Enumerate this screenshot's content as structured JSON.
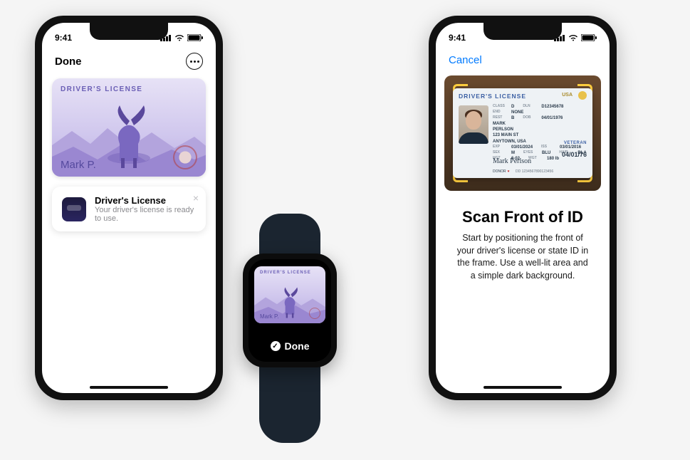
{
  "statusbar": {
    "time": "9:41"
  },
  "left_phone": {
    "done_label": "Done",
    "card": {
      "title": "DRIVER'S LICENSE",
      "holder_name": "Mark P."
    },
    "notification": {
      "title": "Driver's License",
      "subtitle": "Your driver's license is ready to use."
    }
  },
  "watch": {
    "card": {
      "title": "DRIVER'S LICENSE",
      "holder_name": "Mark P."
    },
    "done_label": "Done"
  },
  "right_phone": {
    "cancel_label": "Cancel",
    "scan_title": "Scan Front of ID",
    "scan_body": "Start by positioning the front of your driver's license or state ID in the frame. Use a well-lit area and a simple dark background.",
    "id": {
      "title": "DRIVER'S LICENSE",
      "country": "USA",
      "class_lbl": "CLASS",
      "class": "D",
      "dln_lbl": "DLN",
      "dln": "D12345678",
      "end_lbl": "END",
      "end": "NONE",
      "rest_lbl": "REST",
      "rest": "B",
      "name1": "MARK",
      "name2": "PERLSON",
      "addr1": "123 MAIN ST",
      "addr2": "ANYTOWN, USA",
      "dob_lbl": "DOB",
      "dob": "04/01/1976",
      "exp_lbl": "EXP",
      "exp": "03/01/2024",
      "iss_lbl": "ISS",
      "iss": "03/01/2016",
      "sex_lbl": "SEX",
      "sex": "M",
      "eyes_lbl": "EYES",
      "eyes": "BLU",
      "hair_lbl": "HAIR",
      "hair": "BLA",
      "hgt_lbl": "HGT",
      "hgt": "6-02",
      "wgt_lbl": "WGT",
      "wgt": "180 lb",
      "veteran": "VETERAN",
      "big_date": "04/01/76",
      "signature": "Mark Perlson",
      "donor_lbl": "DONOR",
      "dd_lbl": "DD",
      "dd": "1234567890123456"
    }
  }
}
